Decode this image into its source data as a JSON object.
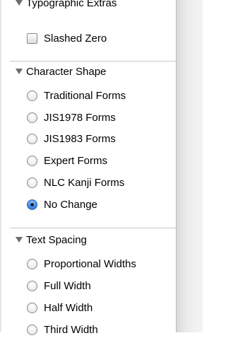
{
  "sections": {
    "typographic_extras": {
      "title": "Typographic Extras",
      "slashed_zero": "Slashed Zero"
    },
    "character_shape": {
      "title": "Character Shape",
      "options": [
        "Traditional Forms",
        "JIS1978 Forms",
        "JIS1983 Forms",
        "Expert Forms",
        "NLC Kanji Forms",
        "No Change"
      ],
      "selected": "No Change"
    },
    "text_spacing": {
      "title": "Text Spacing",
      "options": [
        "Proportional Widths",
        "Full Width",
        "Half Width",
        "Third Width"
      ]
    }
  },
  "icons": {
    "disclosure": "disclosure-triangle-icon"
  },
  "colors": {
    "radio_selected": "#2e79d8",
    "separator": "#c6c6c6"
  }
}
